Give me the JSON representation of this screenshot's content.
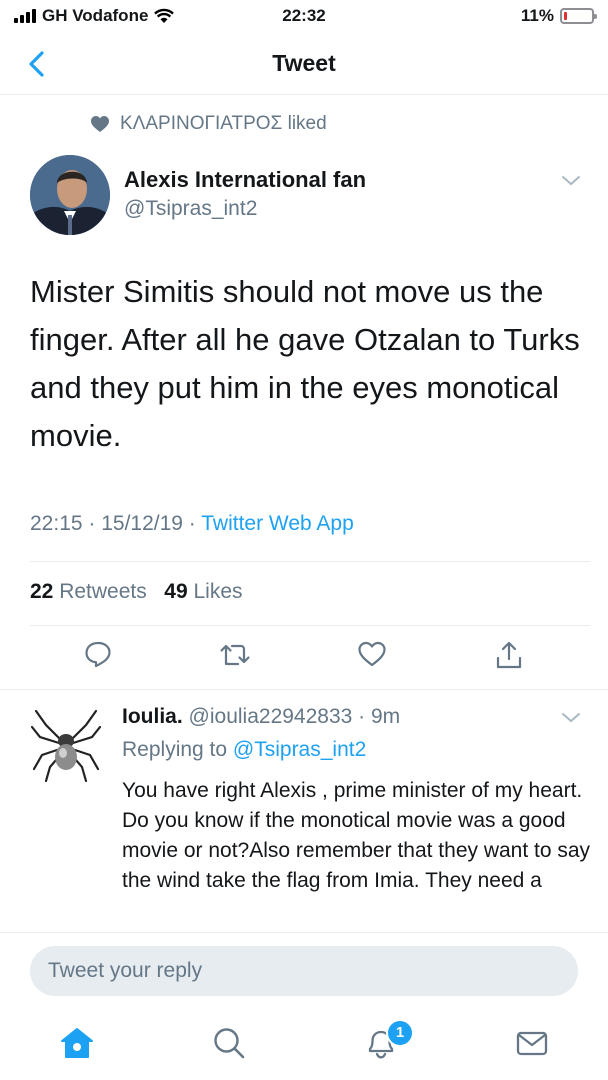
{
  "status_bar": {
    "carrier": "GH Vodafone",
    "time": "22:32",
    "battery": "11%",
    "battery_level": 0.11,
    "battery_color": "#e0302f"
  },
  "nav": {
    "title": "Tweet"
  },
  "social_context": {
    "name": "ΚΛΑΡΙΝΟΓΙΑΤΡΟΣ",
    "action": "liked"
  },
  "tweet": {
    "author_name": "Alexis International fan",
    "author_handle": "@Tsipras_int2",
    "text": "Mister Simitis should not move us the finger. After all he gave Otzalan to Turks and they put him in the eyes monotical movie.",
    "timestamp": "22:15 · 15/12/19 · ",
    "source": "Twitter Web App",
    "retweets_count": "22",
    "retweets_label": "Retweets",
    "likes_count": "49",
    "likes_label": "Likes"
  },
  "actions": [
    "reply-icon",
    "retweet-icon",
    "like-icon",
    "share-icon"
  ],
  "reply": {
    "name": "Ioulia.",
    "handle_time": "@ioulia22942833 · 9m",
    "replying_prefix": "Replying to ",
    "replying_to": "@Tsipras_int2",
    "text": "You have right Alexis , prime minister of my heart. Do you know if the monotical movie was  a good movie or not?Also remember that they want to say the wind take the flag from Imia. They need a"
  },
  "composer": {
    "placeholder": "Tweet your reply"
  },
  "tabbar": {
    "notifications_badge": "1"
  },
  "colors": {
    "accent": "#1da1f2",
    "secondary_text": "#657786",
    "divider": "#e6ecf0"
  }
}
